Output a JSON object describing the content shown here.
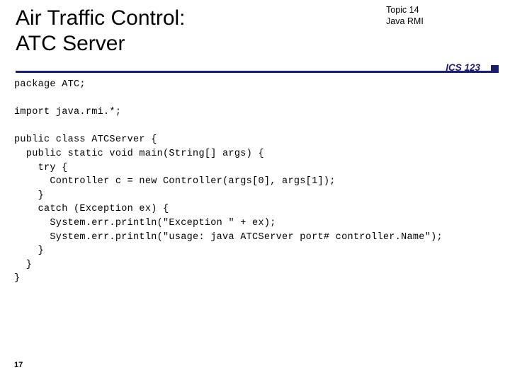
{
  "slide": {
    "title_line1": "Air Traffic Control:",
    "title_line2": "ATC Server",
    "topic_line1": "Topic 14",
    "topic_line2": "Java RMI",
    "course_label": "ICS 123",
    "page_number": "17",
    "accent_color": "#1b1b6f",
    "code_lines": [
      "package ATC;",
      "",
      "import java.rmi.*;",
      "",
      "public class ATCServer {",
      "  public static void main(String[] args) {",
      "    try {",
      "      Controller c = new Controller(args[0], args[1]);",
      "    }",
      "    catch (Exception ex) {",
      "      System.err.println(\"Exception \" + ex);",
      "      System.err.println(\"usage: java ATCServer port# controller.Name\");",
      "    }",
      "  }",
      "}"
    ]
  }
}
